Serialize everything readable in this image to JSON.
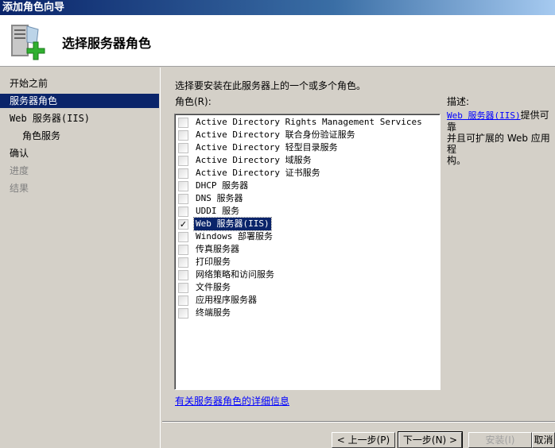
{
  "window": {
    "title": "添加角色向导"
  },
  "header": {
    "title": "选择服务器角色",
    "icon": "server-add-icon"
  },
  "sidebar": {
    "items": [
      {
        "label": "开始之前",
        "state": "normal"
      },
      {
        "label": "服务器角色",
        "state": "selected"
      },
      {
        "label": "Web 服务器(IIS)",
        "state": "normal"
      },
      {
        "label": "角色服务",
        "state": "sub"
      },
      {
        "label": "确认",
        "state": "normal"
      },
      {
        "label": "进度",
        "state": "disabled"
      },
      {
        "label": "结果",
        "state": "disabled"
      }
    ]
  },
  "main": {
    "instruction": "选择要安装在此服务器上的一个或多个角色。",
    "roles_label": "角色(R):",
    "roles": [
      {
        "label": "Active Directory Rights Management Services",
        "checked": false
      },
      {
        "label": "Active Directory 联合身份验证服务",
        "checked": false
      },
      {
        "label": "Active Directory 轻型目录服务",
        "checked": false
      },
      {
        "label": "Active Directory 域服务",
        "checked": false
      },
      {
        "label": "Active Directory 证书服务",
        "checked": false
      },
      {
        "label": "DHCP 服务器",
        "checked": false
      },
      {
        "label": "DNS 服务器",
        "checked": false
      },
      {
        "label": "UDDI 服务",
        "checked": false
      },
      {
        "label": "Web 服务器(IIS)",
        "checked": true,
        "selected": true
      },
      {
        "label": "Windows 部署服务",
        "checked": false
      },
      {
        "label": "传真服务器",
        "checked": false
      },
      {
        "label": "打印服务",
        "checked": false
      },
      {
        "label": "网络策略和访问服务",
        "checked": false
      },
      {
        "label": "文件服务",
        "checked": false
      },
      {
        "label": "应用程序服务器",
        "checked": false
      },
      {
        "label": "终端服务",
        "checked": false
      }
    ],
    "more_info_link": "有关服务器角色的详细信息",
    "description_label": "描述:",
    "description_link": "Web 服务器(IIS)",
    "description_line1": "提供可靠",
    "description_line2": "并且可扩展的 Web 应用程",
    "description_line3": "构。"
  },
  "buttons": {
    "back": "< 上一步(P)",
    "next": "下一步(N) >",
    "install": "安装(I)",
    "cancel": "取消"
  }
}
